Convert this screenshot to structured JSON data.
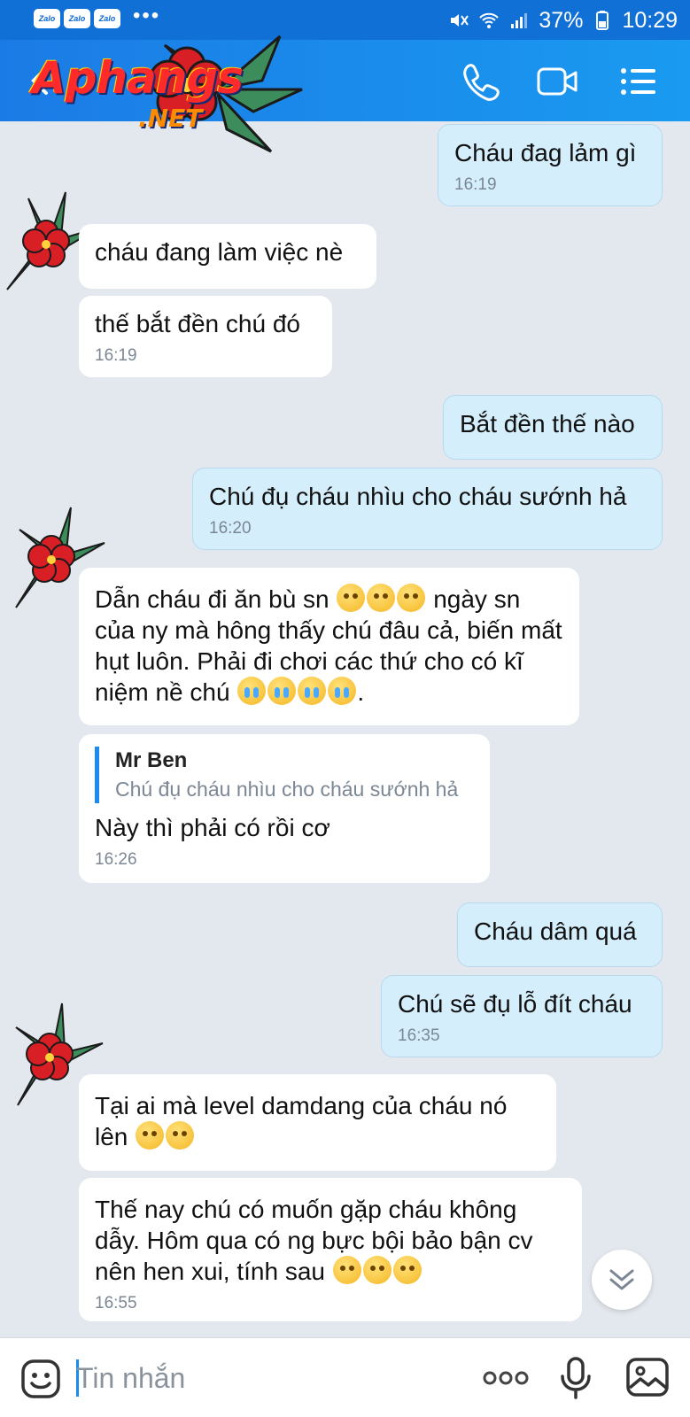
{
  "status_bar": {
    "app_badges": [
      "Zalo",
      "Zalo",
      "Zalo"
    ],
    "more": "•••",
    "battery": "37%",
    "time": "10:29"
  },
  "header": {
    "logo_text": "Aphangs",
    "logo_suffix": ".NET",
    "icons": [
      "back-arrow-icon",
      "phone-icon",
      "video-call-icon",
      "menu-list-icon"
    ]
  },
  "messages": [
    {
      "side": "out",
      "text": "Cháu đag lảm gì",
      "time": "16:19"
    },
    {
      "side": "in",
      "text": "cháu đang làm việc nè",
      "time": ""
    },
    {
      "side": "in",
      "text": "thế bắt đền chú đó",
      "time": "16:19"
    },
    {
      "side": "out",
      "text": "Bắt đền thế nào",
      "time": ""
    },
    {
      "side": "out",
      "text": "Chú đụ cháu nhìu cho cháu sướnh hả",
      "time": "16:20"
    },
    {
      "side": "in",
      "text_parts": [
        "Dẫn cháu đi ăn bù sn",
        " ngày sn của ny mà hông thấy chú đâu cả, biến mất hụt luôn. Phải đi chơi các thứ cho có kĩ niệm nề chú",
        "."
      ],
      "time": ""
    },
    {
      "side": "in",
      "quote_name": "Mr Ben",
      "quote_text": "Chú đụ cháu nhìu cho cháu sướnh hả",
      "text": "Này thì phải có rồi cơ",
      "time": "16:26"
    },
    {
      "side": "out",
      "text": "Cháu dâm quá",
      "time": ""
    },
    {
      "side": "out",
      "text": "Chú sẽ đụ lỗ đít cháu",
      "time": "16:35"
    },
    {
      "side": "in",
      "text": "Tại ai mà level damdang của cháu nó lên",
      "time": ""
    },
    {
      "side": "in",
      "text": "Thế nay chú có muốn gặp cháu không dẫy. Hôm qua có ng bực bội bảo bận cv nên hen xui, tính sau",
      "time": "16:55"
    }
  ],
  "input": {
    "placeholder": "Tin nhắn",
    "value": ""
  },
  "colors": {
    "header": "#1a8cf0",
    "bubble_out": "#d5eefc",
    "bubble_in": "#ffffff",
    "background": "#e3e8ee"
  }
}
